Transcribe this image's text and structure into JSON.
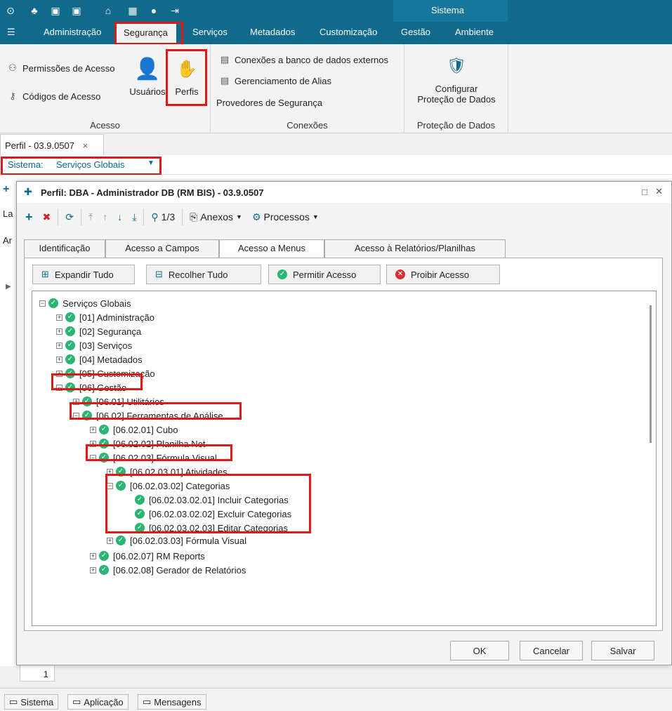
{
  "titlebar": {
    "context": "Sistema"
  },
  "menu": [
    "Administração",
    "Segurança",
    "Serviços",
    "Metadados",
    "Customização",
    "Gestão",
    "Ambiente"
  ],
  "ribbon": {
    "acesso": {
      "label": "Acesso",
      "perm": "Permissões de Acesso",
      "codes": "Códigos de Acesso",
      "users": "Usuários",
      "perfis": "Perfis"
    },
    "conexoes": {
      "label": "Conexões",
      "ext": "Conexões a banco de dados externos",
      "alias": "Gerenciamento de Alias",
      "prov": "Provedores de Segurança"
    },
    "protecao": {
      "label": "Proteção de Dados",
      "config1": "Configurar",
      "config2": "Proteção de Dados"
    }
  },
  "doctab": {
    "label": "Perfil - 03.9.0507",
    "close": "×"
  },
  "sysbar": {
    "label": "Sistema:",
    "value": "Serviços Globais"
  },
  "side": {
    "a": "La",
    "b": "Ar"
  },
  "dialog": {
    "title": "Perfil: DBA - Administrador DB (RM BIS) - 03.9.0507",
    "pager": "1/3",
    "anexos": "Anexos",
    "processos": "Processos",
    "tabs": [
      "Identificação",
      "Acesso a Campos",
      "Acesso a Menus",
      "Acesso à Relatórios/Planilhas"
    ],
    "actions": {
      "expand": "Expandir Tudo",
      "collapse": "Recolher Tudo",
      "allow": "Permitir Acesso",
      "deny": "Proibir Acesso"
    },
    "tree": [
      "Serviços Globais",
      "[01] Administração",
      "[02] Segurança",
      "[03] Serviços",
      "[04] Metadados",
      "[05] Customização",
      "[06] Gestão",
      "[06.01] Utilitários",
      "[06.02] Ferramentas de Análise",
      "[06.02.01] Cubo",
      "[06.02.02] Planilha Net",
      "[06.02.03] Fórmula Visual",
      "[06.02.03.01] Atividades",
      "[06.02.03.02] Categorias",
      "[06.02.03.02.01] Incluir Categorias",
      "[06.02.03.02.02] Excluir Categorias",
      "[06.02.03.02.03] Editar Categorias",
      "[06.02.03.03] Fórmula Visual",
      "[06.02.07] RM Reports",
      "[06.02.08] Gerador de Relatórios"
    ],
    "ok": "OK",
    "cancel": "Cancelar",
    "save": "Salvar"
  },
  "pager_value": "1",
  "status": {
    "sistema": "Sistema",
    "aplicacao": "Aplicação",
    "mensagens": "Mensagens"
  }
}
